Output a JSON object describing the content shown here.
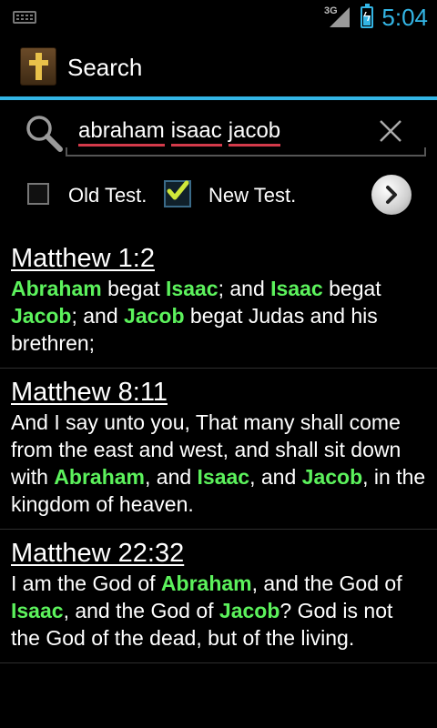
{
  "status_bar": {
    "network": "3G",
    "time": "5:04",
    "icons": [
      "keyboard-icon",
      "signal-icon",
      "battery-charging-icon"
    ]
  },
  "action_bar": {
    "title": "Search",
    "app_icon": "bible-icon"
  },
  "search": {
    "words": [
      "abraham",
      "isaac",
      "jacob"
    ],
    "icon": "search-icon",
    "clear_icon": "close-icon"
  },
  "filters": {
    "old_testament": {
      "label": "Old Test.",
      "checked": false
    },
    "new_testament": {
      "label": "New Test.",
      "checked": true
    },
    "go_icon": "chevron-right-icon"
  },
  "accent_colors": {
    "holo_blue": "#33b5e5",
    "highlight": "#5cf25c",
    "spell_underline": "#d43a4a"
  },
  "results": [
    {
      "reference": "Matthew 1:2",
      "segments": [
        {
          "t": "Abraham",
          "hl": true
        },
        {
          "t": " begat ",
          "hl": false
        },
        {
          "t": "Isaac",
          "hl": true
        },
        {
          "t": "; and ",
          "hl": false
        },
        {
          "t": "Isaac",
          "hl": true
        },
        {
          "t": " begat ",
          "hl": false
        },
        {
          "t": "Jacob",
          "hl": true
        },
        {
          "t": "; and ",
          "hl": false
        },
        {
          "t": "Jacob",
          "hl": true
        },
        {
          "t": " begat Judas and his brethren;",
          "hl": false
        }
      ]
    },
    {
      "reference": "Matthew 8:11",
      "segments": [
        {
          "t": "And I say unto you, That many shall come from the east and west, and shall sit down with ",
          "hl": false
        },
        {
          "t": "Abraham",
          "hl": true
        },
        {
          "t": ", and ",
          "hl": false
        },
        {
          "t": "Isaac",
          "hl": true
        },
        {
          "t": ", and ",
          "hl": false
        },
        {
          "t": "Jacob",
          "hl": true
        },
        {
          "t": ", in the kingdom of heaven.",
          "hl": false
        }
      ]
    },
    {
      "reference": "Matthew 22:32",
      "segments": [
        {
          "t": "I am the God of ",
          "hl": false
        },
        {
          "t": "Abraham",
          "hl": true
        },
        {
          "t": ", and the God of ",
          "hl": false
        },
        {
          "t": "Isaac",
          "hl": true
        },
        {
          "t": ", and the God of ",
          "hl": false
        },
        {
          "t": "Jacob",
          "hl": true
        },
        {
          "t": "? God is not the God of the dead, but of the living.",
          "hl": false
        }
      ]
    }
  ]
}
